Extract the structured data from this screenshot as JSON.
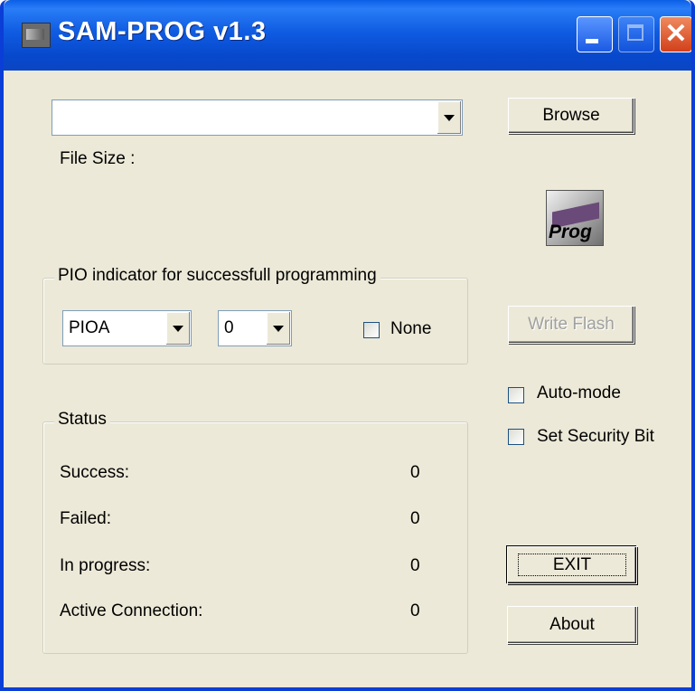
{
  "window": {
    "title": "SAM-PROG v1.3",
    "close_glyph": "✕"
  },
  "file": {
    "path_value": "",
    "size_label": "File Size :"
  },
  "buttons": {
    "browse": "Browse",
    "write_flash": "Write Flash",
    "exit": "EXIT",
    "about": "About"
  },
  "prog_icon": {
    "label": "Prog"
  },
  "pio": {
    "group_title": "PIO indicator for successfull programming",
    "port_value": "PIOA",
    "pin_value": "0",
    "none_label": "None",
    "none_checked": false
  },
  "options": {
    "auto_mode_label": "Auto-mode",
    "auto_mode_checked": false,
    "security_label": "Set Security Bit",
    "security_checked": false
  },
  "status": {
    "group_title": "Status",
    "rows": [
      {
        "label": "Success:",
        "value": "0"
      },
      {
        "label": "Failed:",
        "value": "0"
      },
      {
        "label": "In progress:",
        "value": "0"
      },
      {
        "label": "Active Connection:",
        "value": "0"
      }
    ]
  },
  "colors": {
    "titlebar": "#0a5fe6",
    "face": "#ece9d8",
    "close": "#d1401b"
  }
}
